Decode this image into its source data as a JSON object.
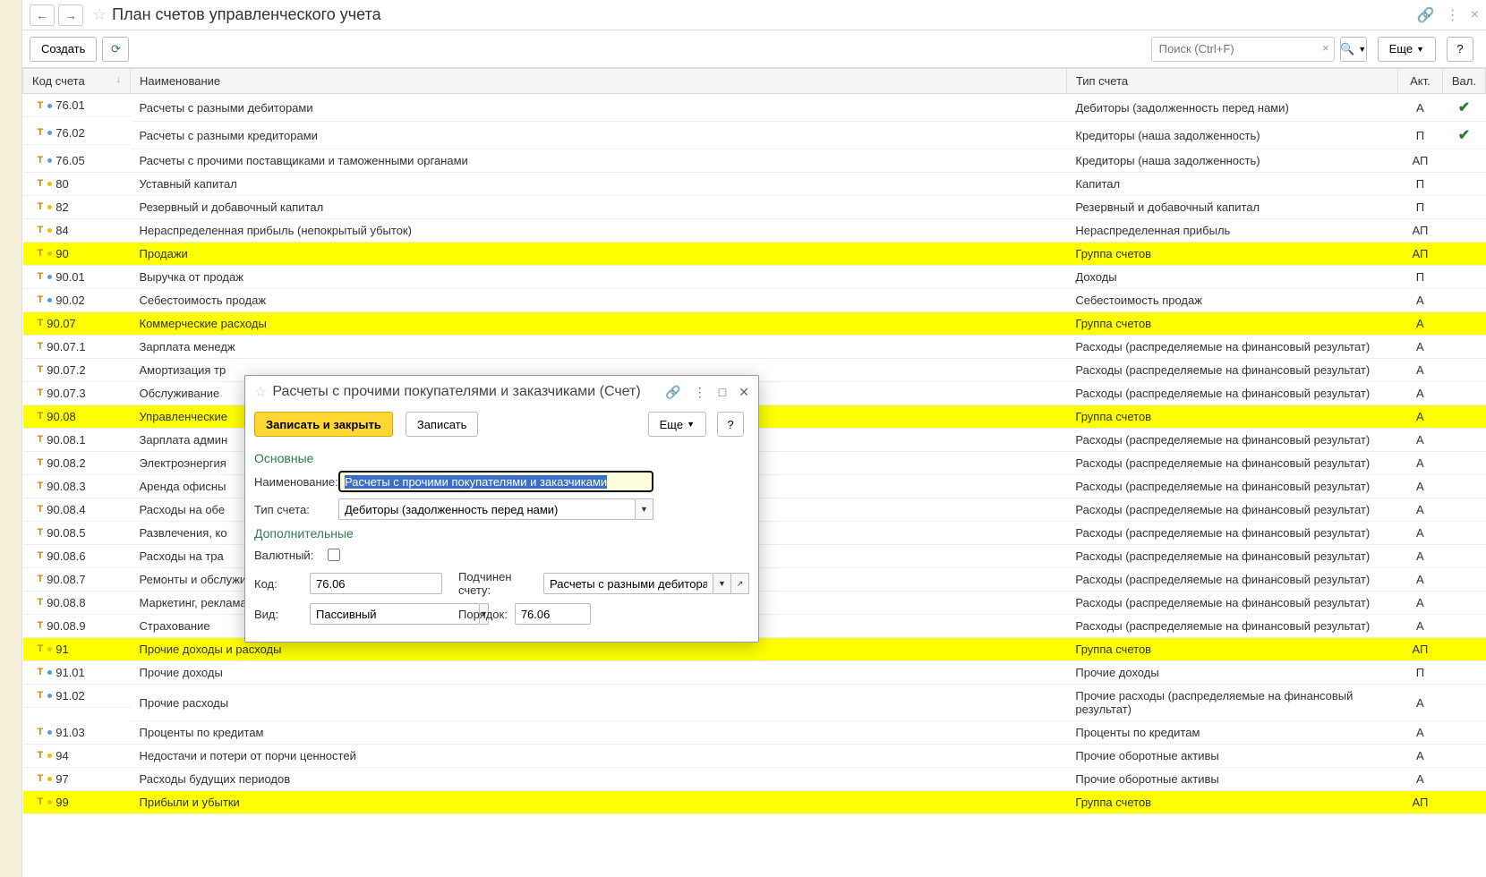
{
  "page_title": "План счетов управленческого учета",
  "toolbar": {
    "create_label": "Создать",
    "search_placeholder": "Поиск (Ctrl+F)",
    "more_label": "Еще",
    "help_label": "?"
  },
  "columns": {
    "code": "Код счета",
    "name": "Наименование",
    "type": "Тип счета",
    "akt": "Акт.",
    "val": "Вал."
  },
  "rows": [
    {
      "code": "76.01",
      "name": "Расчеты с разными дебиторами",
      "type": "Дебиторы (задолженность перед нами)",
      "akt": "А",
      "val": true,
      "dot": "blue",
      "hl": false
    },
    {
      "code": "76.02",
      "name": "Расчеты с разными кредиторами",
      "type": "Кредиторы (наша задолженность)",
      "akt": "П",
      "val": true,
      "dot": "blue",
      "hl": false
    },
    {
      "code": "76.05",
      "name": "Расчеты с прочими поставщиками и таможенными органами",
      "type": "Кредиторы (наша задолженность)",
      "akt": "АП",
      "val": false,
      "dot": "blue",
      "hl": false
    },
    {
      "code": "80",
      "name": "Уставный капитал",
      "type": "Капитал",
      "akt": "П",
      "val": false,
      "dot": "yellow",
      "hl": false
    },
    {
      "code": "82",
      "name": "Резервный и добавочный капитал",
      "type": "Резервный и добавочный капитал",
      "akt": "П",
      "val": false,
      "dot": "yellow",
      "hl": false
    },
    {
      "code": "84",
      "name": "Нераспределенная прибыль (непокрытый убыток)",
      "type": "Нераспределенная прибыль",
      "akt": "АП",
      "val": false,
      "dot": "yellow",
      "hl": false
    },
    {
      "code": "90",
      "name": "Продажи",
      "type": "Группа счетов",
      "akt": "АП",
      "val": false,
      "dot": "yellow",
      "hl": true
    },
    {
      "code": "90.01",
      "name": "Выручка от продаж",
      "type": "Доходы",
      "akt": "П",
      "val": false,
      "dot": "blue",
      "hl": false
    },
    {
      "code": "90.02",
      "name": "Себестоимость продаж",
      "type": "Себестоимость продаж",
      "akt": "А",
      "val": false,
      "dot": "blue",
      "hl": false
    },
    {
      "code": "90.07",
      "name": "Коммерческие расходы",
      "type": "Группа счетов",
      "akt": "А",
      "val": false,
      "dot": "",
      "hl": true
    },
    {
      "code": "90.07.1",
      "name": "Зарплата менедж",
      "type": "Расходы (распределяемые на финансовый результат)",
      "akt": "А",
      "val": false,
      "dot": "",
      "hl": false
    },
    {
      "code": "90.07.2",
      "name": "Амортизация тр",
      "type": "Расходы (распределяемые на финансовый результат)",
      "akt": "А",
      "val": false,
      "dot": "",
      "hl": false
    },
    {
      "code": "90.07.3",
      "name": "Обслуживание ",
      "type": "Расходы (распределяемые на финансовый результат)",
      "akt": "А",
      "val": false,
      "dot": "",
      "hl": false
    },
    {
      "code": "90.08",
      "name": "Управленческие",
      "type": "Группа счетов",
      "akt": "А",
      "val": false,
      "dot": "",
      "hl": true
    },
    {
      "code": "90.08.1",
      "name": "Зарплата админ",
      "type": "Расходы (распределяемые на финансовый результат)",
      "akt": "А",
      "val": false,
      "dot": "",
      "hl": false
    },
    {
      "code": "90.08.2",
      "name": "Электроэнергия",
      "type": "Расходы (распределяемые на финансовый результат)",
      "akt": "А",
      "val": false,
      "dot": "",
      "hl": false
    },
    {
      "code": "90.08.3",
      "name": "Аренда офисны",
      "type": "Расходы (распределяемые на финансовый результат)",
      "akt": "А",
      "val": false,
      "dot": "",
      "hl": false
    },
    {
      "code": "90.08.4",
      "name": "Расходы на обе",
      "type": "Расходы (распределяемые на финансовый результат)",
      "akt": "А",
      "val": false,
      "dot": "",
      "hl": false
    },
    {
      "code": "90.08.5",
      "name": "Развлечения, ко",
      "type": "Расходы (распределяемые на финансовый результат)",
      "akt": "А",
      "val": false,
      "dot": "",
      "hl": false
    },
    {
      "code": "90.08.6",
      "name": "Расходы на тра",
      "type": "Расходы (распределяемые на финансовый результат)",
      "akt": "А",
      "val": false,
      "dot": "",
      "hl": false
    },
    {
      "code": "90.08.7",
      "name": "Ремонты и обслуживание",
      "type": "Расходы (распределяемые на финансовый результат)",
      "akt": "А",
      "val": false,
      "dot": "",
      "hl": false
    },
    {
      "code": "90.08.8",
      "name": "Маркетинг, реклама",
      "type": "Расходы (распределяемые на финансовый результат)",
      "akt": "А",
      "val": false,
      "dot": "",
      "hl": false
    },
    {
      "code": "90.08.9",
      "name": "Страхование",
      "type": "Расходы (распределяемые на финансовый результат)",
      "akt": "А",
      "val": false,
      "dot": "",
      "hl": false
    },
    {
      "code": "91",
      "name": "Прочие доходы и расходы",
      "type": "Группа счетов",
      "akt": "АП",
      "val": false,
      "dot": "yellow",
      "hl": true
    },
    {
      "code": "91.01",
      "name": "Прочие доходы",
      "type": "Прочие доходы",
      "akt": "П",
      "val": false,
      "dot": "blue",
      "hl": false
    },
    {
      "code": "91.02",
      "name": "Прочие расходы",
      "type": "Прочие расходы (распределяемые на финансовый результат)",
      "akt": "А",
      "val": false,
      "dot": "blue",
      "hl": false
    },
    {
      "code": "91.03",
      "name": "Проценты по кредитам",
      "type": "Проценты по кредитам",
      "akt": "А",
      "val": false,
      "dot": "blue",
      "hl": false
    },
    {
      "code": "94",
      "name": "Недостачи и потери от порчи ценностей",
      "type": "Прочие оборотные активы",
      "akt": "А",
      "val": false,
      "dot": "yellow",
      "hl": false
    },
    {
      "code": "97",
      "name": "Расходы будущих периодов",
      "type": "Прочие оборотные активы",
      "akt": "А",
      "val": false,
      "dot": "yellow",
      "hl": false
    },
    {
      "code": "99",
      "name": "Прибыли и убытки",
      "type": "Группа счетов",
      "akt": "АП",
      "val": false,
      "dot": "yellow",
      "hl": true
    }
  ],
  "dialog": {
    "title": "Расчеты с прочими покупателями и заказчиками (Счет)",
    "save_close": "Записать и закрыть",
    "save": "Записать",
    "more": "Еще",
    "help": "?",
    "section_main": "Основные",
    "section_extra": "Дополнительные",
    "labels": {
      "name": "Наименование:",
      "type": "Тип счета:",
      "currency": "Валютный:",
      "code": "Код:",
      "parent": "Подчинен счету:",
      "kind": "Вид:",
      "order": "Порядок:"
    },
    "values": {
      "name": "Расчеты с прочими покупателями и заказчиками",
      "type": "Дебиторы (задолженность перед нами)",
      "code": "76.06",
      "parent": "Расчеты с разными дебиторами и кред",
      "kind": "Пассивный",
      "order": "76.06"
    }
  }
}
